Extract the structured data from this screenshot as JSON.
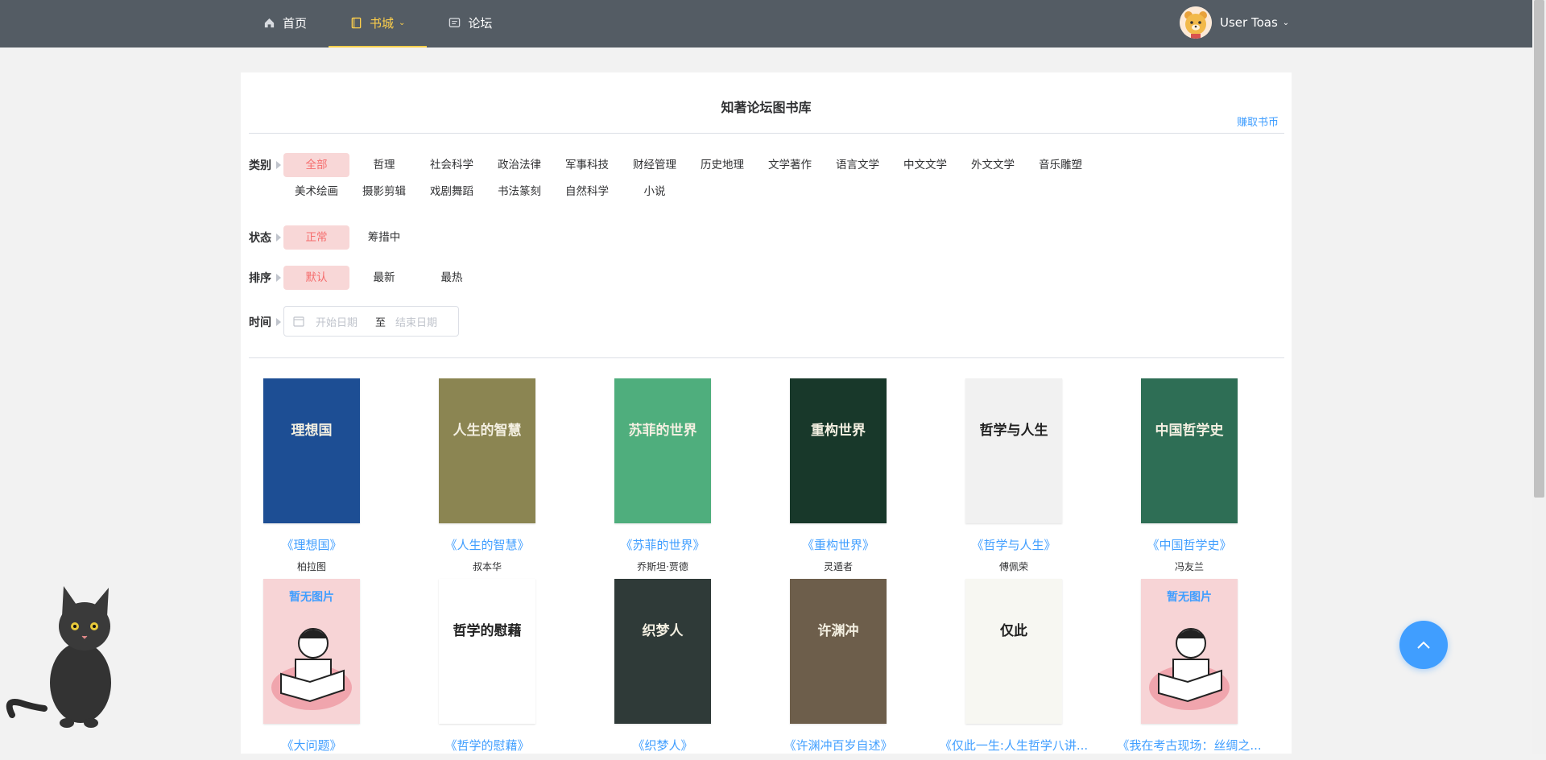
{
  "nav": {
    "items": [
      {
        "label": "首页",
        "icon": "home-icon"
      },
      {
        "label": "书城",
        "icon": "book-icon",
        "active": true
      },
      {
        "label": "论坛",
        "icon": "forum-icon"
      }
    ]
  },
  "user": {
    "name": "User Toas"
  },
  "page": {
    "title": "知著论坛图书库",
    "earn_link": "赚取书币"
  },
  "filters": {
    "category": {
      "label": "类别",
      "options": [
        "全部",
        "哲理",
        "社会科学",
        "政治法律",
        "军事科技",
        "财经管理",
        "历史地理",
        "文学著作",
        "语言文学",
        "中文文学",
        "外文文学",
        "音乐雕塑",
        "美术绘画",
        "摄影剪辑",
        "戏剧舞蹈",
        "书法篆刻",
        "自然科学",
        "小说"
      ],
      "selected": "全部"
    },
    "status": {
      "label": "状态",
      "options": [
        "正常",
        "筹措中"
      ],
      "selected": "正常"
    },
    "sort": {
      "label": "排序",
      "options": [
        "默认",
        "最新",
        "最热"
      ],
      "selected": "默认"
    },
    "time": {
      "label": "时间",
      "start_placeholder": "开始日期",
      "separator": "至",
      "end_placeholder": "结束日期"
    }
  },
  "books": [
    {
      "title": "《理想国》",
      "author": "柏拉图",
      "cover_text": "理想国",
      "cover_color": "#1d4e94"
    },
    {
      "title": "《人生的智慧》",
      "author": "叔本华",
      "cover_text": "人生的智慧",
      "cover_color": "#8b8552"
    },
    {
      "title": "《苏菲的世界》",
      "author": "乔斯坦·贾德",
      "cover_text": "苏菲的世界",
      "cover_color": "#4fae7d"
    },
    {
      "title": "《重构世界》",
      "author": "灵遁者",
      "cover_text": "重构世界",
      "cover_color": "#18382a"
    },
    {
      "title": "《哲学与人生》",
      "author": "傅佩荣",
      "cover_text": "哲学与人生",
      "cover_color": "#f1f1f1"
    },
    {
      "title": "《中国哲学史》",
      "author": "冯友兰",
      "cover_text": "中国哲学史",
      "cover_color": "#2e6e55"
    },
    {
      "title": "《大问题》",
      "author": "",
      "cover_text": "暂无图片",
      "cover_color": "#f7d4d6"
    },
    {
      "title": "《哲学的慰藉》",
      "author": "",
      "cover_text": "哲学的慰藉",
      "cover_color": "#ffffff"
    },
    {
      "title": "《织梦人》",
      "author": "",
      "cover_text": "织梦人",
      "cover_color": "#2f3a38"
    },
    {
      "title": "《许渊冲百岁自述》",
      "author": "",
      "cover_text": "许渊冲",
      "cover_color": "#6d5e4b"
    },
    {
      "title": "《仅此一生:人生哲学八讲...",
      "author": "",
      "cover_text": "仅此",
      "cover_color": "#f7f7f2"
    },
    {
      "title": "《我在考古现场：丝绸之...",
      "author": "",
      "cover_text": "暂无图片",
      "cover_color": "#f7d4d6"
    }
  ]
}
